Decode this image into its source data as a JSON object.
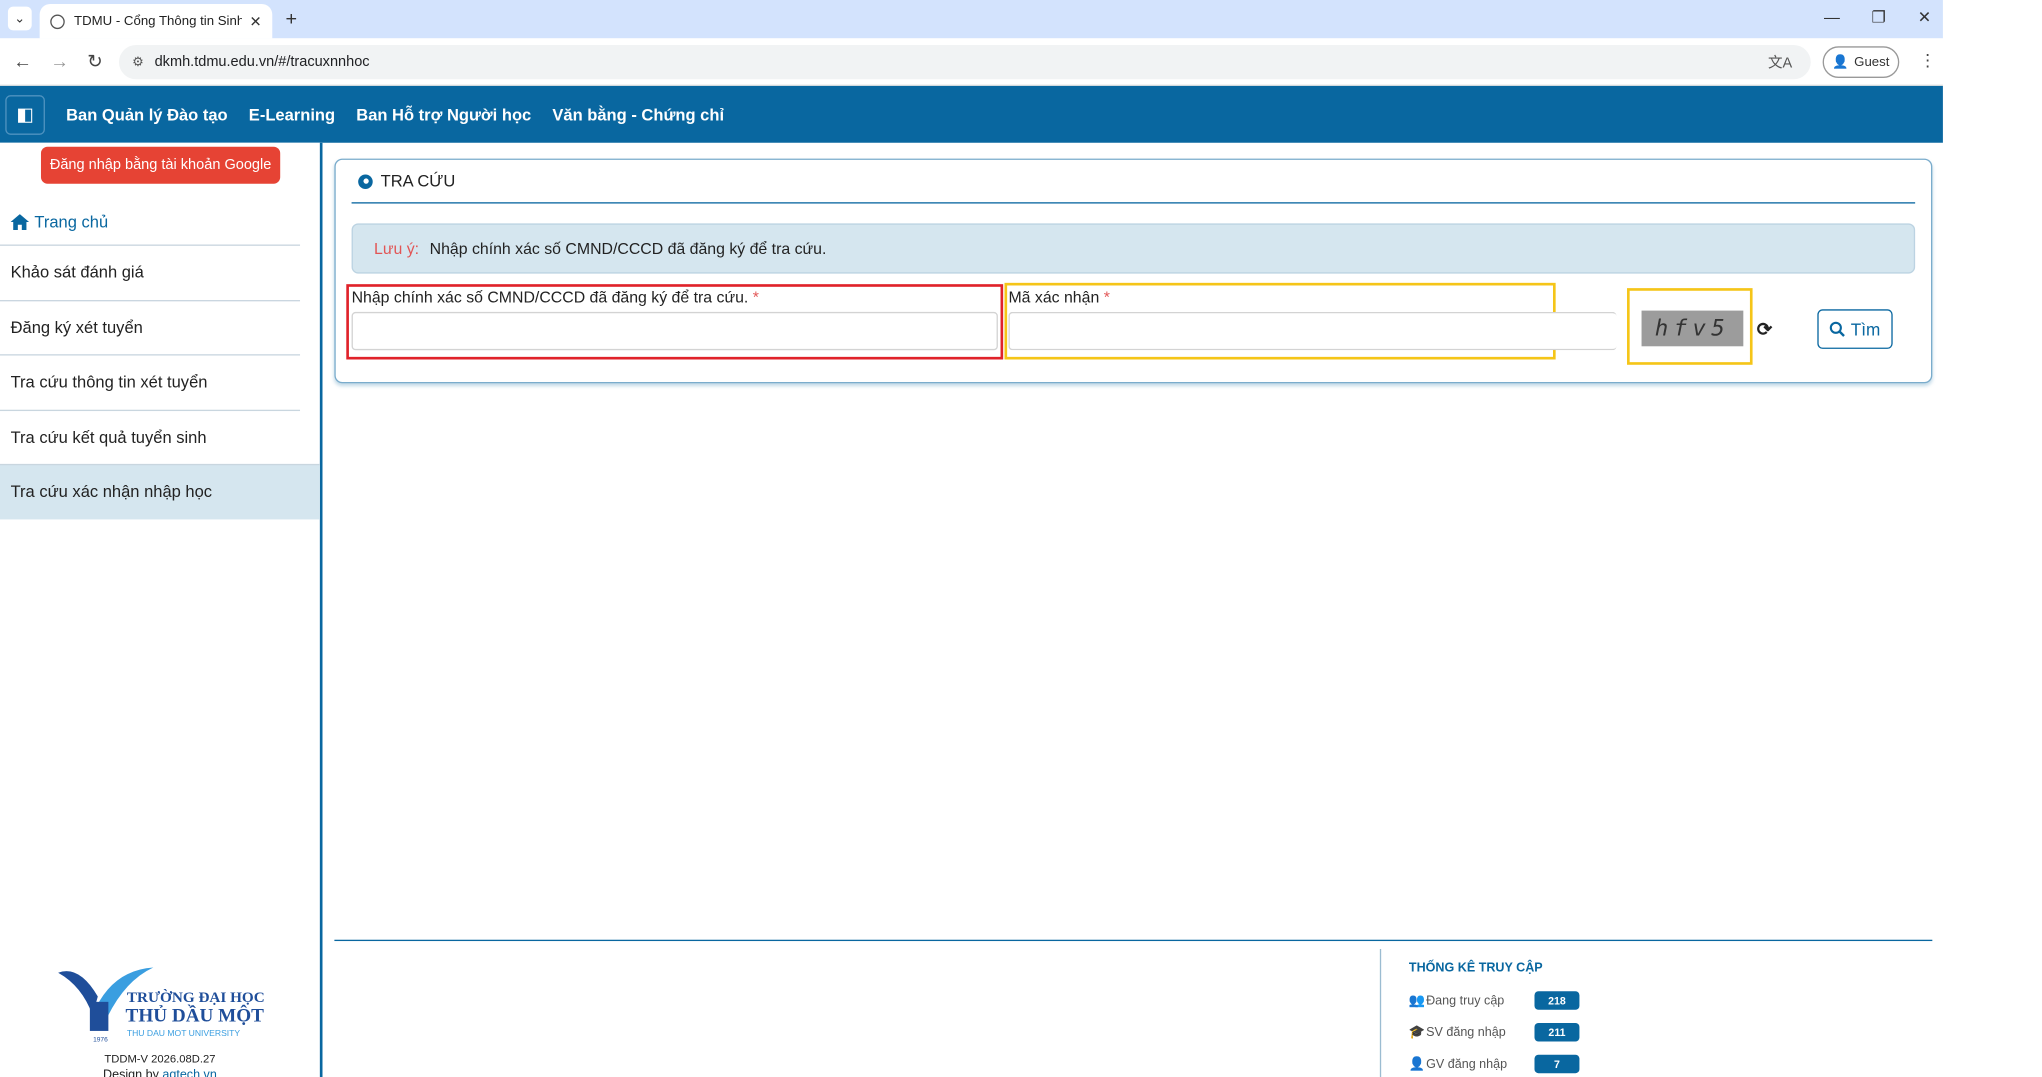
{
  "browser": {
    "tab_title": "TDMU - Cổng Thông tin Sinh v",
    "url": "dkmh.tdmu.edu.vn/#/tracuxnnhoc",
    "profile_label": "Guest"
  },
  "nav": {
    "items": [
      "Ban Quản lý Đào tạo",
      "E-Learning",
      "Ban Hỗ trợ Người học",
      "Văn bằng - Chứng chỉ"
    ]
  },
  "sidebar": {
    "google_login": "Đăng nhập bằng tài khoản Google",
    "home": "Trang chủ",
    "items": [
      "Khảo sát đánh giá",
      "Đăng ký xét tuyển",
      "Tra cứu thông tin xét tuyển",
      "Tra cứu kết quả tuyển sinh",
      "Tra cứu xác nhận nhập học"
    ],
    "logo_line1": "TRƯỜNG ĐẠI HỌC",
    "logo_line2": "THỦ DẦU MỘT",
    "logo_line3": "THU DAU MOT UNIVERSITY",
    "logo_year": "1976",
    "version": "TDDM-V 2026.08D.27",
    "design_prefix": "Design by",
    "design_link": "aqtech.vn"
  },
  "main": {
    "title": "TRA CỨU",
    "note_label": "Lưu ý:",
    "note_text": "Nhập chính xác số CMND/CCCD đã đăng ký để tra cứu.",
    "field1_label": "Nhập chính xác số CMND/CCCD đã đăng ký để tra cứu.",
    "field2_label": "Mã xác nhận",
    "required_mark": "*",
    "captcha_text": "hfv5",
    "search_button": "Tìm"
  },
  "stats": {
    "title": "THỐNG KÊ TRUY CẬP",
    "rows": [
      {
        "label": "Đang truy cập",
        "value": "218"
      },
      {
        "label": "SV đăng nhập",
        "value": "211"
      },
      {
        "label": "GV đăng nhập",
        "value": "7"
      }
    ]
  },
  "colors": {
    "brand_blue": "#0967a0",
    "google_red": "#e64334",
    "highlight_red": "#e0222a",
    "highlight_yellow": "#f5c518"
  }
}
